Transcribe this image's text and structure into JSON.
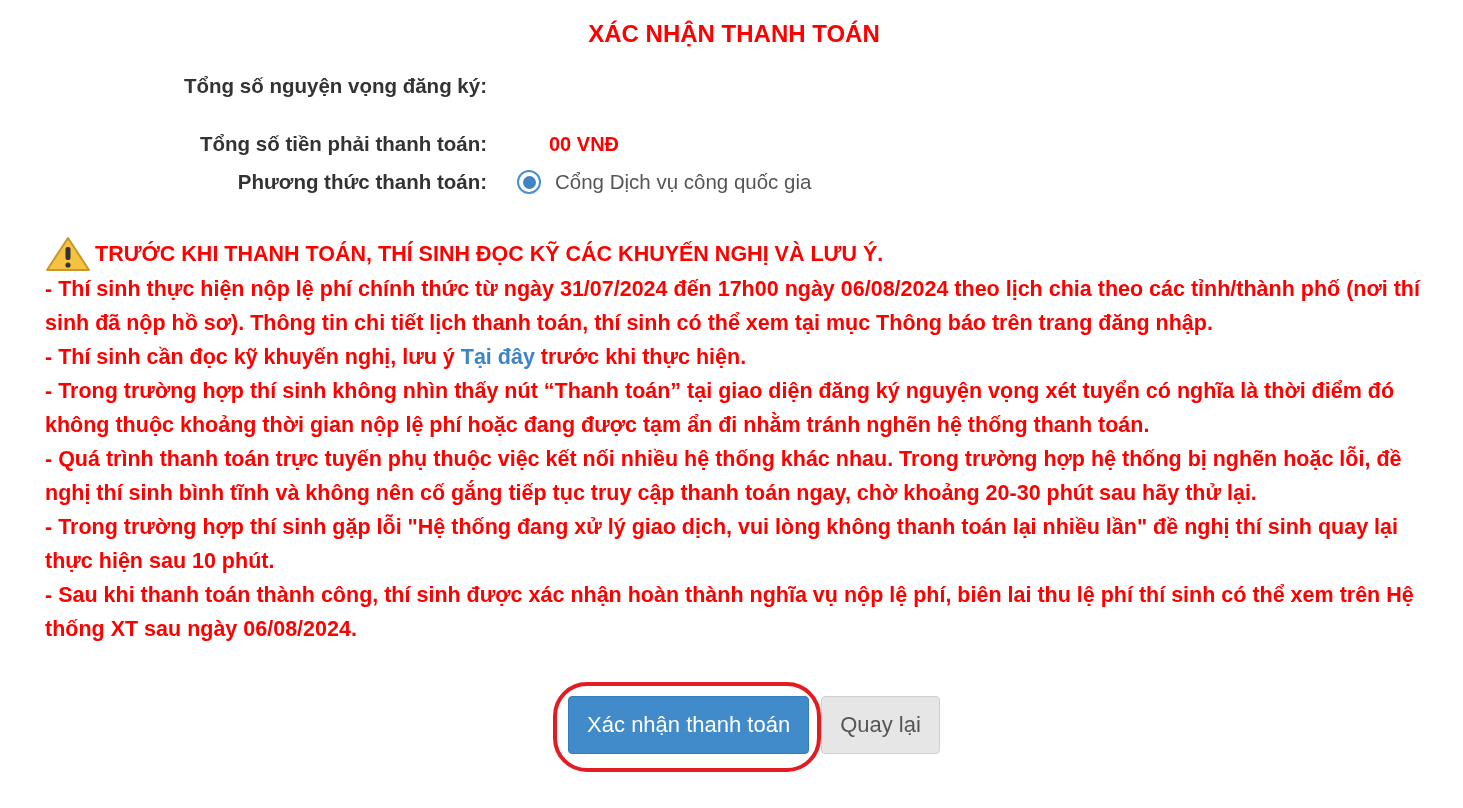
{
  "title": "XÁC NHẬN THANH TOÁN",
  "fields": [
    {
      "kind": "text",
      "label": "Tổng số nguyện vọng đăng ký:"
    },
    {
      "kind": "amount",
      "label": "Tổng số tiền phải thanh toán:",
      "value": "00 VNĐ"
    },
    {
      "kind": "radio",
      "label": "Phương thức thanh toán:",
      "option": "Cổng Dịch vụ công quốc gia",
      "selected": true
    }
  ],
  "warning": "TRƯỚC KHI THANH TOÁN, THÍ SINH ĐỌC KỸ CÁC KHUYẾN NGHỊ VÀ LƯU Ý.",
  "notes": [
    {
      "text": "- Thí sinh thực hiện nộp lệ phí chính thức từ ngày 31/07/2024 đến 17h00 ngày 06/08/2024 theo lịch chia theo các tỉnh/thành phố (nơi thí sinh đã nộp hồ sơ). Thông tin chi tiết lịch thanh toán, thí sinh có thể xem tại mục Thông báo trên trang đăng nhập."
    },
    {
      "text": "- Thí sinh cần đọc kỹ khuyến nghị, lưu ý ",
      "link": "Tại đây",
      "after": " trước khi thực hiện."
    },
    {
      "text": "- Trong trường hợp thí sinh không nhìn thấy nút “Thanh toán” tại giao diện đăng ký nguyện vọng xét tuyển có nghĩa là thời điểm đó không thuộc khoảng thời gian nộp lệ phí hoặc đang được tạm ẩn đi nhằm tránh nghẽn hệ thống thanh toán."
    },
    {
      "text": "- Quá trình thanh toán trực tuyến phụ thuộc việc kết nối nhiều hệ thống khác nhau. Trong trường hợp hệ thống bị nghẽn hoặc lỗi, đề nghị thí sinh bình tĩnh và không nên cố gắng tiếp tục truy cập thanh toán ngay, chờ khoảng 20-30 phút sau hãy thử lại."
    },
    {
      "text": "- Trong trường hợp thí sinh gặp lỗi \"Hệ thống đang xử lý giao dịch, vui lòng không thanh toán lại nhiều lần\" đề nghị thí sinh quay lại thực hiện sau 10 phút."
    },
    {
      "text": "- Sau khi thanh toán thành công, thí sinh được xác nhận hoàn thành nghĩa vụ nộp lệ phí, biên lai thu lệ phí thí sinh có thể xem trên Hệ thống XT sau ngày 06/08/2024."
    }
  ],
  "buttons": [
    {
      "kind": "primary",
      "label": "Xác nhận thanh toán",
      "circled": true
    },
    {
      "kind": "default",
      "label": "Quay lại",
      "circled": false
    }
  ]
}
